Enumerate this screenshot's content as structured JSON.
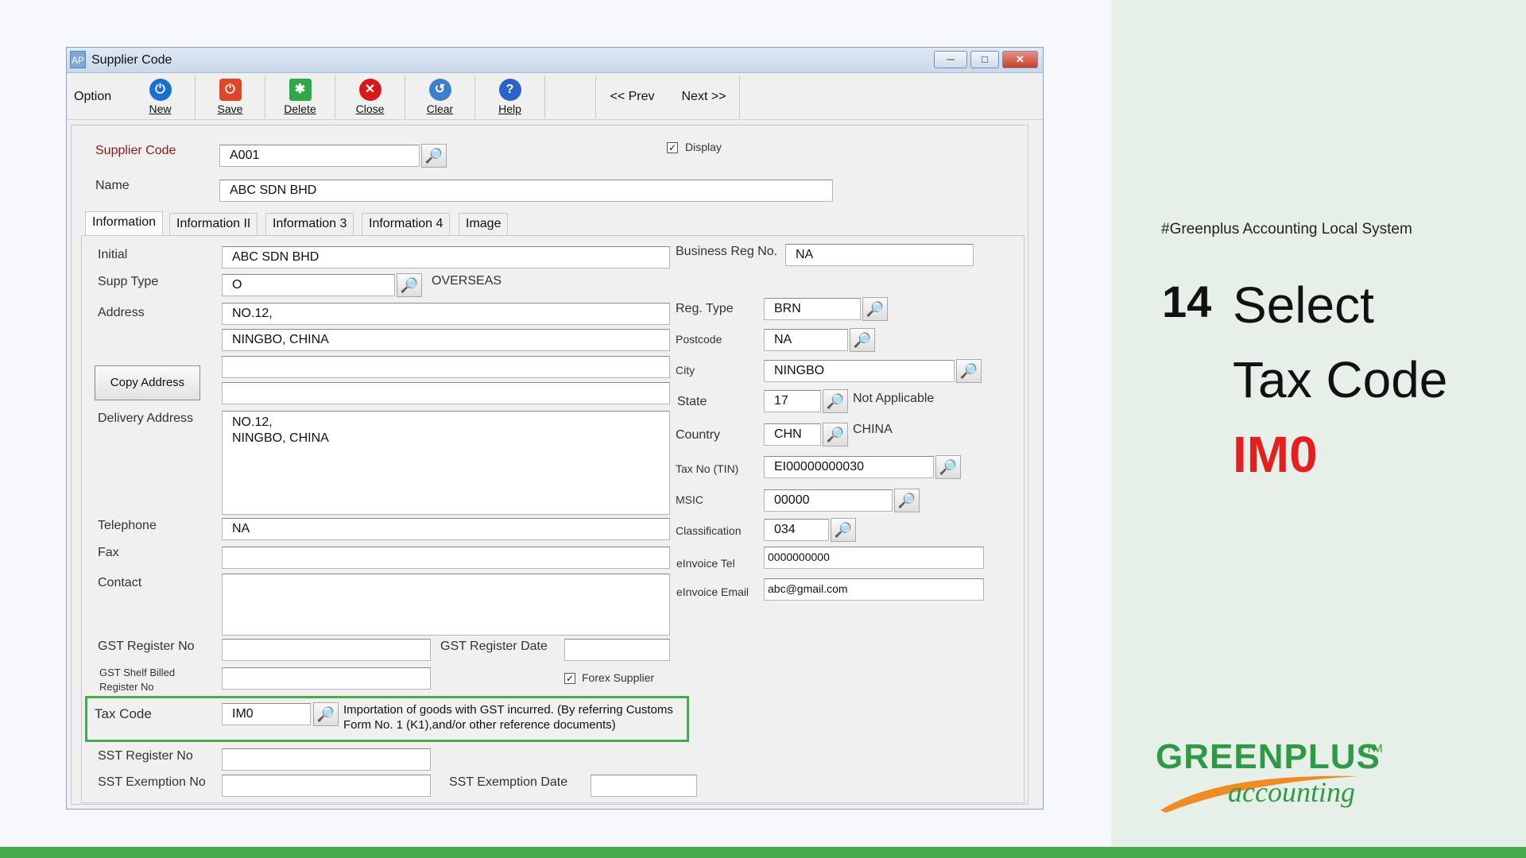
{
  "window": {
    "title": "Supplier Code",
    "app_icon": "AP",
    "controls": [
      "minimize-icon",
      "maximize-icon",
      "close-icon"
    ]
  },
  "toolbar": {
    "option_label": "Option",
    "buttons": [
      {
        "label": "New",
        "icon": "power-icon",
        "color": "#1a6fd1"
      },
      {
        "label": "Save",
        "icon": "save-icon",
        "color": "#e0452a"
      },
      {
        "label": "Delete",
        "icon": "delete-icon",
        "color": "#2fa84a"
      },
      {
        "label": "Close",
        "icon": "close-icon",
        "color": "#d7191c"
      },
      {
        "label": "Clear",
        "icon": "clear-icon",
        "color": "#3d7fc9"
      },
      {
        "label": "Help",
        "icon": "help-icon",
        "color": "#2a64c9"
      }
    ],
    "prev_label": "<<  Prev",
    "next_label": "Next  >>"
  },
  "header": {
    "supplier_code_label": "Supplier Code",
    "supplier_code_value": "A001",
    "name_label": "Name",
    "name_value": "ABC SDN BHD",
    "display_label": "Display",
    "display_checked": true
  },
  "tabs": [
    "Information",
    "Information II",
    "Information 3",
    "Information 4",
    "Image"
  ],
  "left": {
    "initial_label": "Initial",
    "initial_value": "ABC SDN BHD",
    "supp_type_label": "Supp Type",
    "supp_type_value": "O",
    "supp_type_desc": "OVERSEAS",
    "address_label": "Address",
    "address_lines": [
      "NO.12,",
      "NINGBO, CHINA",
      "",
      ""
    ],
    "copy_address_label": "Copy Address",
    "delivery_address_label": "Delivery Address",
    "delivery_address_lines": [
      "NO.12,",
      "NINGBO, CHINA"
    ],
    "telephone_label": "Telephone",
    "telephone_value": "NA",
    "fax_label": "Fax",
    "fax_value": "",
    "contact_label": "Contact",
    "contact_value": "",
    "gst_register_no_label": "GST Register No",
    "gst_register_date_label": "GST Register Date",
    "gst_shelf_label_1": "GST Shelf Billed",
    "gst_shelf_label_2": "Register No",
    "forex_supplier_label": "Forex Supplier",
    "forex_supplier_checked": true,
    "tax_code_label": "Tax Code",
    "tax_code_value": "IM0",
    "tax_code_desc": "Importation of goods with GST incurred. (By referring Customs Form No. 1 (K1),and/or other reference documents)",
    "sst_register_no_label": "SST Register No",
    "sst_exemption_no_label": "SST Exemption No",
    "sst_exemption_date_label": "SST Exemption Date"
  },
  "right": {
    "business_reg_label": "Business Reg No.",
    "business_reg_value": "NA",
    "reg_type_label": "Reg. Type",
    "reg_type_value": "BRN",
    "postcode_label": "Postcode",
    "postcode_value": "NA",
    "city_label": "City",
    "city_value": "NINGBO",
    "state_label": "State",
    "state_value": "17",
    "state_desc": "Not Applicable",
    "country_label": "Country",
    "country_value": "CHN",
    "country_desc": "CHINA",
    "tax_no_label": "Tax No (TIN)",
    "tax_no_value": "EI00000000030",
    "msic_label": "MSIC",
    "msic_value": "00000",
    "classification_label": "Classification",
    "classification_value": "034",
    "einvoice_tel_label": "eInvoice Tel",
    "einvoice_tel_value": "0000000000",
    "einvoice_email_label": "eInvoice Email",
    "einvoice_email_value": "abc@gmail.com"
  },
  "side_panel": {
    "hashtag": "#Greenplus Accounting Local System",
    "step_number": "14",
    "step_line1": "Select",
    "step_line2": "Tax Code",
    "step_line3": "IM0",
    "highlight_color": "#e41f1f",
    "logo_text": "GREENPLUS",
    "logo_tm": "TM",
    "logo_sub": "accounting",
    "brand_color": "#2e9a45"
  }
}
